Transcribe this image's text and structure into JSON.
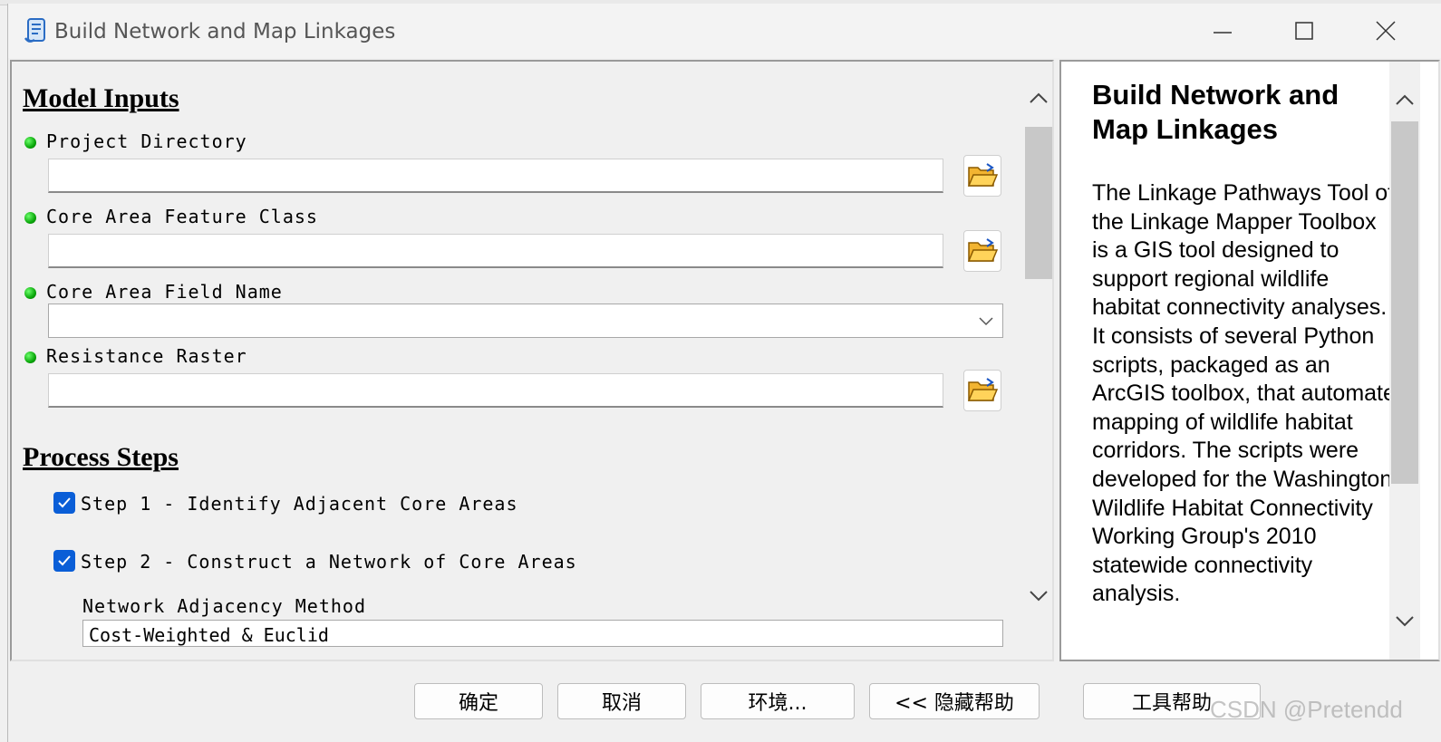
{
  "window": {
    "title": "Build Network and Map Linkages"
  },
  "form": {
    "model_inputs_heading": "Model Inputs",
    "params": [
      {
        "label": "Project Directory",
        "value": ""
      },
      {
        "label": "Core Area Feature Class",
        "value": ""
      },
      {
        "label": "Core Area Field Name",
        "value": ""
      },
      {
        "label": "Resistance Raster",
        "value": ""
      }
    ],
    "process_steps_heading": "Process Steps",
    "steps": [
      {
        "label": "Step 1 - Identify Adjacent Core Areas",
        "checked": true
      },
      {
        "label": "Step 2 - Construct a Network of Core Areas",
        "checked": true
      }
    ],
    "network_adjacency_label": "Network Adjacency Method",
    "network_adjacency_value": "Cost-Weighted & Euclid"
  },
  "help": {
    "title": "Build Network and Map Linkages",
    "body": "The Linkage Pathways Tool of the Linkage Mapper Toolbox is a GIS tool designed to support regional wildlife habitat connectivity analyses. It consists of several Python scripts, packaged as an ArcGIS toolbox, that automate mapping of wildlife habitat corridors. The scripts were developed for the Washington Wildlife Habitat Connectivity Working Group's 2010 statewide connectivity analysis."
  },
  "buttons": {
    "ok": "确定",
    "cancel": "取消",
    "environments": "环境...",
    "hide_help": "<< 隐藏帮助",
    "tool_help": "工具帮助"
  },
  "watermark": "CSDN @Pretendd",
  "colors": {
    "checkbox": "#0a5ed7",
    "required_dot": "#0aa70a",
    "folder": "#f2b431"
  }
}
